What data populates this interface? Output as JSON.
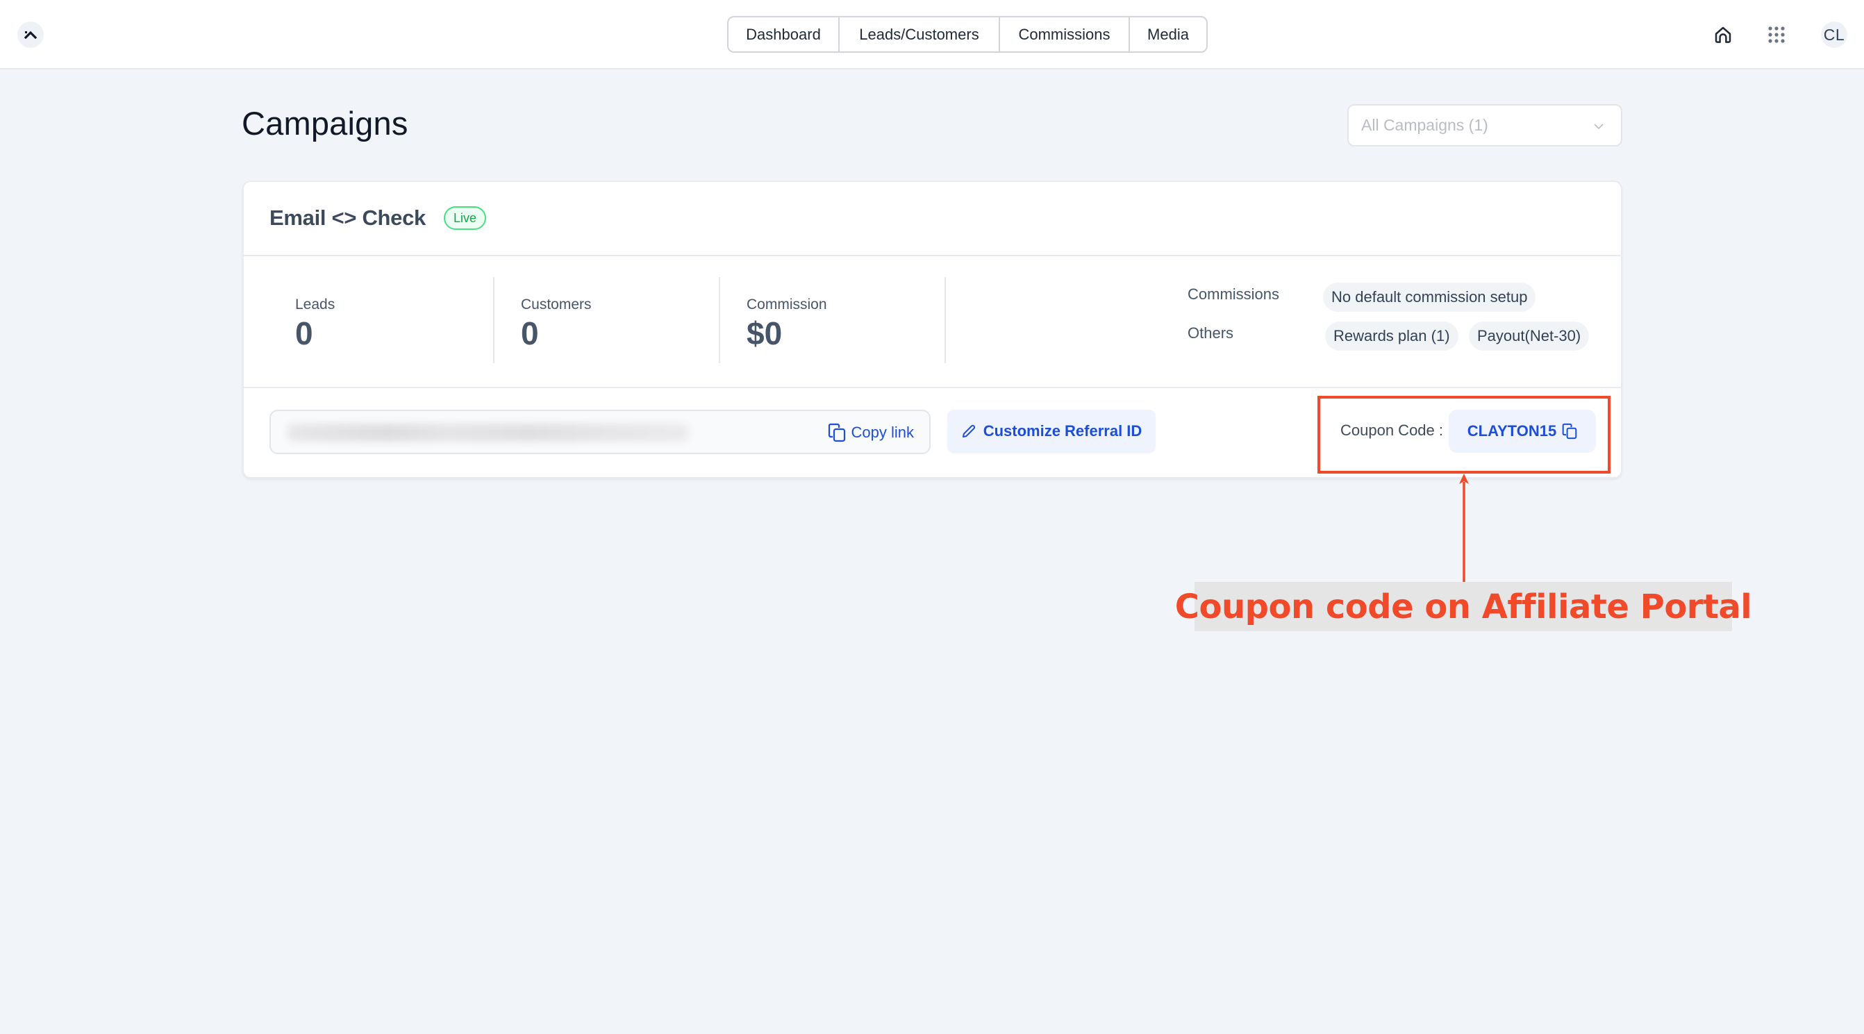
{
  "header": {
    "logo_icon": "chevron-up-icon",
    "nav_tabs": [
      {
        "label": "Dashboard"
      },
      {
        "label": "Leads/Customers"
      },
      {
        "label": "Commissions"
      },
      {
        "label": "Media"
      }
    ],
    "icons": [
      "home-icon",
      "apps-grid-icon"
    ],
    "avatar_initials": "CL"
  },
  "page": {
    "title": "Campaigns",
    "campaign_filter": {
      "selected": "All Campaigns (1)"
    }
  },
  "campaign": {
    "name": "Email <> Check",
    "status": "Live",
    "stats": [
      {
        "label": "Leads",
        "value": "0"
      },
      {
        "label": "Customers",
        "value": "0"
      },
      {
        "label": "Commission",
        "value": "$0"
      }
    ],
    "meta": {
      "commissions_label": "Commissions",
      "commissions_value": "No default commission setup",
      "others_label": "Others",
      "others_values": [
        "Rewards plan (1)",
        "Payout(Net-30)"
      ]
    },
    "referral": {
      "copy_link_label": "Copy link",
      "customize_label": "Customize Referral ID"
    },
    "coupon": {
      "label": "Coupon Code :",
      "code": "CLAYTON15"
    }
  },
  "annotation": {
    "text": "Coupon code on Affiliate Portal",
    "color": "#f04a2a"
  },
  "colors": {
    "accent": "#1d4ed8",
    "live_green": "#16a34a",
    "background": "#f1f5f9"
  }
}
